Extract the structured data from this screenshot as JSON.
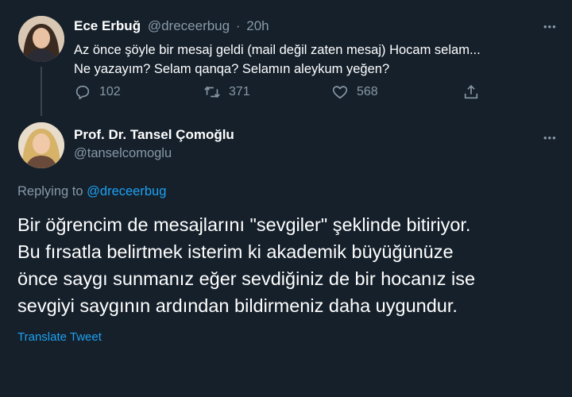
{
  "tweet1": {
    "name": "Ece Erbuğ",
    "handle": "@dreceerbug",
    "separator": "·",
    "time": "20h",
    "text_line1": "Az önce şöyle bir mesaj geldi (mail değil zaten mesaj) Hocam selam...",
    "text_line2": "Ne yazayım? Selam qanqa? Selamın aleykum yeğen?",
    "replies": "102",
    "retweets": "371",
    "likes": "568",
    "more": "•••"
  },
  "tweet2": {
    "name": "Prof. Dr. Tansel Çomoğlu",
    "handle": "@tanselcomoglu",
    "more": "•••",
    "replying_label": "Replying to",
    "replying_handle": "@dreceerbug",
    "text_line1": "Bir öğrencim de mesajlarını \"sevgiler\" şeklinde bitiriyor.",
    "text_line2": "Bu fırsatla belirtmek isterim ki akademik büyüğünüze",
    "text_line3": "önce saygı sunmanız eğer sevdiğiniz de bir hocanız ise",
    "text_line4": "sevgiyi saygının ardından bildirmeniz daha uygundur.",
    "translate": "Translate Tweet"
  },
  "colors": {
    "background": "#15202b",
    "muted": "#8899a6",
    "link": "#1da1f2"
  }
}
